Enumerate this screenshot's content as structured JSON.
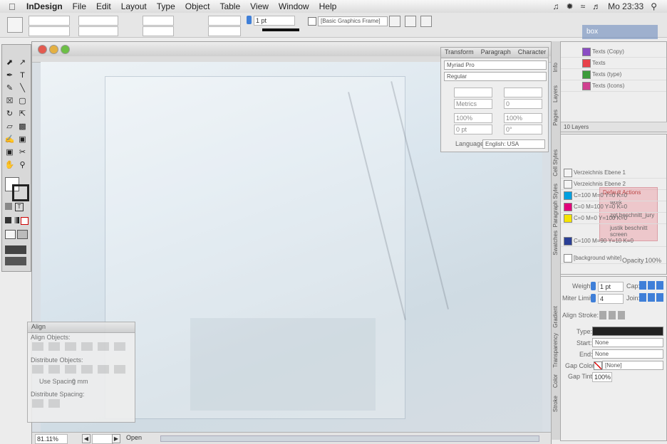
{
  "menubar": {
    "app_name": "InDesign",
    "items": [
      "File",
      "Edit",
      "Layout",
      "Type",
      "Object",
      "Table",
      "View",
      "Window",
      "Help"
    ],
    "clock": "Mo 23:33"
  },
  "control": {
    "stroke_weight": "1 pt",
    "object_style": "[Basic Graphics Frame]"
  },
  "character_panel": {
    "tabs": [
      "Transform",
      "Paragraph",
      "Character"
    ],
    "font_family": "Myriad Pro",
    "font_style": "Regular",
    "tracking": "Metrics",
    "kerning": "0",
    "h_scale": "100%",
    "v_scale": "100%",
    "baseline": "0 pt",
    "skew": "0°",
    "language_label": "Language:",
    "language": "English: USA"
  },
  "layers_panel": {
    "header": "box",
    "items": [
      "Texts (Copy)",
      "Texts",
      "Texts (type)",
      "Texts (Icons)"
    ],
    "footer": "10 Layers"
  },
  "swatches_panel": {
    "rows": [
      "Verzeichnis Ebene 1",
      "Verzeichnis Ebene 2",
      "C=100 M=0 Y=0 K=0",
      "C=0 M=100 Y=0 K=0",
      "C=0 M=0 Y=100 K=0",
      "C=100 M=90 Y=10 K=0",
      "[background white]"
    ],
    "opacity_label": "Opacity",
    "opacity": "100%",
    "action_title": "Default Actions",
    "action_items": [
      "work",
      "zgt beschnitt_jury",
      "justik beschnitt screen"
    ]
  },
  "stroke_panel": {
    "weight_label": "Weight:",
    "weight": "1 pt",
    "cap_label": "Cap:",
    "miter_label": "Miter Limit:",
    "miter": "4",
    "join_label": "Join:",
    "align_label": "Align Stroke:",
    "type_label": "Type:",
    "start_label": "Start:",
    "start": "None",
    "end_label": "End:",
    "end": "None",
    "gap_color_label": "Gap Color:",
    "gap_color": "[None]",
    "gap_tint_label": "Gap Tint:",
    "gap_tint": "100%"
  },
  "side_tabs": [
    "Info",
    "Layers",
    "Pages",
    "Cell Styles",
    "Paragraph Styles",
    "Swatches",
    "Gradient",
    "Transparency",
    "Color",
    "Stroke"
  ],
  "align_panel": {
    "tabs": [
      "Align"
    ],
    "align_objects_label": "Align Objects:",
    "distribute_objects_label": "Distribute Objects:",
    "use_spacing_label": "Use Spacing",
    "spacing": "0 mm",
    "distribute_spacing_label": "Distribute Spacing:"
  },
  "status": {
    "zoom": "81.11%",
    "state": "Open"
  }
}
